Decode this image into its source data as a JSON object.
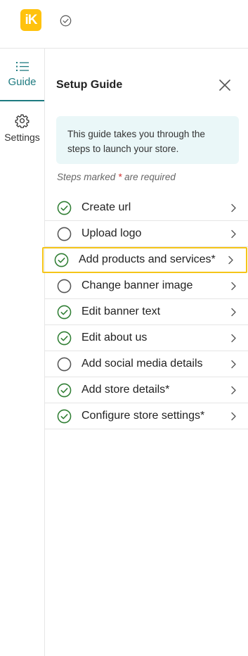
{
  "header": {
    "logo_text": "iK",
    "logo_color": "#ffc20e"
  },
  "rail": {
    "guide_label": "Guide",
    "settings_label": "Settings",
    "accent_color": "#1e7b80"
  },
  "panel": {
    "title": "Setup Guide",
    "info_text": "This guide takes you through the steps to launch your store.",
    "required_note_before": "Steps marked ",
    "required_note_star": "*",
    "required_note_after": " are required"
  },
  "steps": [
    {
      "label": "Create url",
      "completed": true
    },
    {
      "label": "Upload logo",
      "completed": false
    },
    {
      "label": "Add products and services*",
      "completed": true,
      "highlighted": true
    },
    {
      "label": "Change banner image",
      "completed": false
    },
    {
      "label": "Edit banner text",
      "completed": true
    },
    {
      "label": "Edit about us",
      "completed": true
    },
    {
      "label": "Add social media details",
      "completed": false
    },
    {
      "label": "Add store details*",
      "completed": true
    },
    {
      "label": "Configure store settings*",
      "completed": true
    }
  ],
  "colors": {
    "check_green": "#2e7d32",
    "highlight_yellow": "#f5c518",
    "info_bg": "#eaf7f8"
  }
}
